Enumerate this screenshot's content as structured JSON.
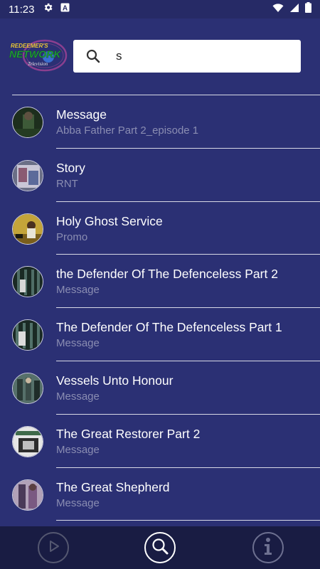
{
  "status_bar": {
    "time": "11:23",
    "icons": [
      "gear-icon",
      "a-badge-icon",
      "wifi-icon",
      "signal-icon",
      "battery-icon"
    ]
  },
  "header": {
    "logo_top": "REDEEMER'S",
    "logo_main": "NETWORK",
    "logo_bottom": "Television"
  },
  "search": {
    "value": "s",
    "icon": "search-icon"
  },
  "results": [
    {
      "title": "Message",
      "subtitle": "Abba Father Part 2_episode 1"
    },
    {
      "title": "Story",
      "subtitle": "RNT"
    },
    {
      "title": "Holy Ghost Service",
      "subtitle": "Promo"
    },
    {
      "title": "the Defender Of The Defenceless Part 2",
      "subtitle": "Message"
    },
    {
      "title": "The Defender Of The Defenceless Part 1",
      "subtitle": "Message"
    },
    {
      "title": "Vessels Unto Honour",
      "subtitle": "Message"
    },
    {
      "title": "The Great Restorer Part 2",
      "subtitle": "Message"
    },
    {
      "title": "The Great Shepherd",
      "subtitle": "Message"
    }
  ],
  "bottom_nav": {
    "items": [
      "play-icon",
      "search-icon",
      "info-icon"
    ],
    "active": "search-icon"
  },
  "colors": {
    "background": "#2b3074",
    "statusbar": "#262a66",
    "bottombar": "#191c43",
    "subtitle": "#8a8db2",
    "divider": "#d8d9e6"
  }
}
